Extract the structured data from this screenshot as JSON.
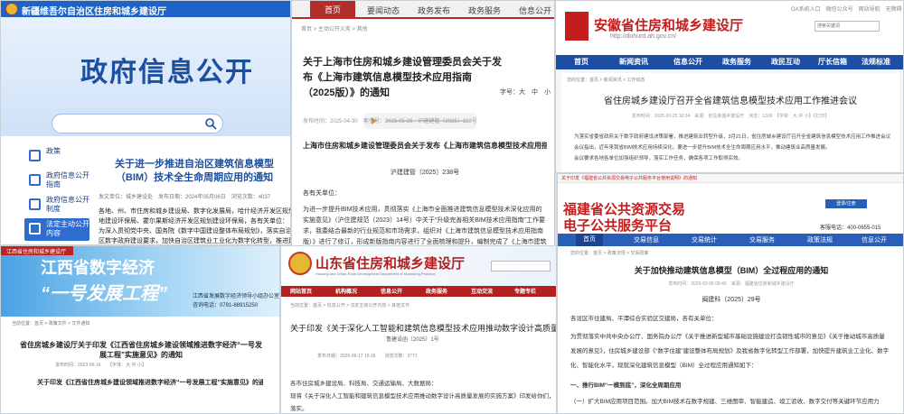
{
  "panel_a": {
    "header_title": "新疆维吾尔自治区住房和城乡建设厅",
    "banner_title": "政府信息公开",
    "sidebar": [
      "政策",
      "政府信息公开指南",
      "政府信息公开制度",
      "法定主动公开内容"
    ],
    "article_title": "关于进一步推进自治区建筑信息模型（BIM）技术全生命周期应用的通知",
    "meta": "发文单位：城乡建设处　发布日期：2024年05月06日　浏览次数：4037",
    "lines": [
      "各地、州、市住房和城乡建设局、数字化发展局，哈什经济开发区规划土",
      "地建设环保局、霍尔果斯经济开发区规划建设环保局，各有关单位：",
      "为深入贯彻党中央、国务院《数字中国建设整体布局规划》，落实自治",
      "区数字政府建设要求，加快自治区建筑业工业化为数字化转型，推进建筑"
    ]
  },
  "panel_b": {
    "nav": [
      "首页",
      "要闻动态",
      "政务发布",
      "政务服务",
      "信息公开"
    ],
    "crumb": "首页 > 主动公开义务 > 其他",
    "title": "关于上海市住房和城乡建设管理委员会关于发布《上海市建筑信息模型技术应用指南（2025版）》的通知",
    "meta": "发布时间：2025-04-30　索引号：2025-05-29　沪建建管〔2025〕238号",
    "font_label": "字号：",
    "font_sizes": [
      "大",
      "中",
      "小"
    ],
    "h2": "上海市住房和城乡建设管理委员会关于发布《上海市建筑信息模型技术应用指南（2025版）》的通知",
    "doc_no": "沪建建管〔2025〕238号",
    "body": [
      "各有关单位：",
      "为进一步提升BIM技术应用，贯彻落实《上海市全面推进建筑信息模型技术深化应用的",
      "实施意见》（沪住建规范〔2023〕14号）中关于“升级完善相关BIM技术应用指南”工作要",
      "求，我委结合最新的行业规范和市场需求，组织对《上海市建筑信息模型技术应用指南（2017",
      "版）》进行了修订，形成新版指南内容进行了全面梳理和提升，编制完成了《上海市建筑信息模型"
    ]
  },
  "panel_c": {
    "title": "安徽省住房和城乡建设厅",
    "url": "http://dohurd.ah.gov.cn/",
    "top_links": "OA系统入口　微信公众号　网站导航　无障碍",
    "search_placeholder": "搜索关键词",
    "nav": [
      "首页",
      "新闻资讯",
      "信息公开",
      "政务服务",
      "政民互动",
      "厅长信箱",
      "法规标准"
    ],
    "crumb": "您的位置：首页 > 新闻资讯 > 工作动态",
    "article_title": "省住房城乡建设厅召开全省建筑信息模型技术应用工作推进会议",
    "meta": "发布时间：2025-03-25 10:34　来源：省住房城乡建设厅　浏览：1309　【字体：大 中 小】【打印】",
    "body": [
      "为落实省委省政府关于数字政府建设决策部署，推进建筑业转型升级，3月21日，省住房城乡建设厅召开全省建筑信息模型技术应用工作推进会议。",
      "会议指出，近年来我省BIM技术应用持续深化，要进一步提升BIM技术全生命周期应用水平，推动建筑业高质量发展。",
      "会议要求各地各单位加强组织领导，落实工作任务，确保各项工作取得实效。"
    ]
  },
  "panel_d": {
    "top_label": "江西省住房和城乡建设厅",
    "banner_line1": "江西省数字经济",
    "banner_line2": "“一号发展工程”",
    "banner_sub1": "江西省发展数字经济领导小组办公室",
    "banner_sub2": "咨询电话：0791-88915250",
    "crumb": "当前位置：首页 > 政策文件 > 文件通知",
    "title": "省住房城乡建设厅关于印发《江西省住房城乡建设领域推进数字经济“一号发展工程”实施意见》的通知",
    "meta": "发布时间：2023-06-16　　【字体：大 中 小】",
    "h2": "关于印发《江西省住房城乡建设领域推进数字经济“一号发展工程”实施意见》的通知"
  },
  "panel_e": {
    "title": "山东省住房和城乡建设厅",
    "english": "Housing and Urban-Rural Development Department of Shandong Province",
    "nav": [
      "网站首页",
      "机构概况",
      "信息公开",
      "政务服务",
      "互动交流",
      "专题专栏"
    ],
    "crumb": "当前位置：首页 > 信息公开 > 法定主动公开内容 > 其他文件",
    "title_article": "关于印发《关于深化人工智能和建筑信息模型技术应用推动数字设计高质量发展的通知》",
    "doc_no": "鲁建设函〔2025〕1号",
    "meta": "发布日期：2025-06-17 16:16　　浏览次数：3771",
    "body": [
      "各市住房城乡建设局、科技局、交通运输局、大数据局：",
      "现将《关于深化人工智能和建筑信息模型技术应用推动数字设计高质量发展的实施方案》印发给你们，请结合实际认真",
      "落实。"
    ]
  },
  "panel_f": {
    "top_link": "关于印发《福建省公共资源交易电子公共服务平台使用说明》的通知",
    "title_line1": "福建省公共资源交易",
    "title_line2": "电子公共服务平台",
    "login": "登录/注册",
    "phone": "客服电话：400-0655-015",
    "nav": [
      "首页",
      "交易信息",
      "交易统计",
      "交易服务",
      "政策法规",
      "信息公开"
    ],
    "crumb": "您的位置：首页 > 政策法规 > 交易政策",
    "article_title": "关于加快推动建筑信息模型（BIM）全过程应用的通知",
    "meta": "发布时间：2025-02-06 08:45　来源：福建省住房和城乡建设厅",
    "doc_no": "闽建科〔2025〕29号",
    "body": [
      "各设区市住建局、平潭综合实验区交建局，各有关单位：",
      "为贯彻落实中共中央办公厅、国务院办公厅《关于推进新型城市基础设施建设打造韧性城市的意见》《关于推动城市高质量",
      "发展的意见》，住房城乡建设部《“数字住建”建设整体布局规划》及我省数字化转型工作部署，加快提升建筑业工业化、数字",
      "化、智能化水平，现就深化建筑信息模型（BIM）全过程应用通知如下：",
      "一、推行BIM“一模到底”，深化全周期应用",
      "（一）扩大BIM应用项目范围。加大BIM技术在数字规建、三维图审、智能建造、竣工验收、数字交付等关键环节应用力"
    ]
  },
  "colors": {
    "blue": "#1f63c6",
    "red": "#b32e2a",
    "fujian_blue": "#2a5fb9"
  }
}
